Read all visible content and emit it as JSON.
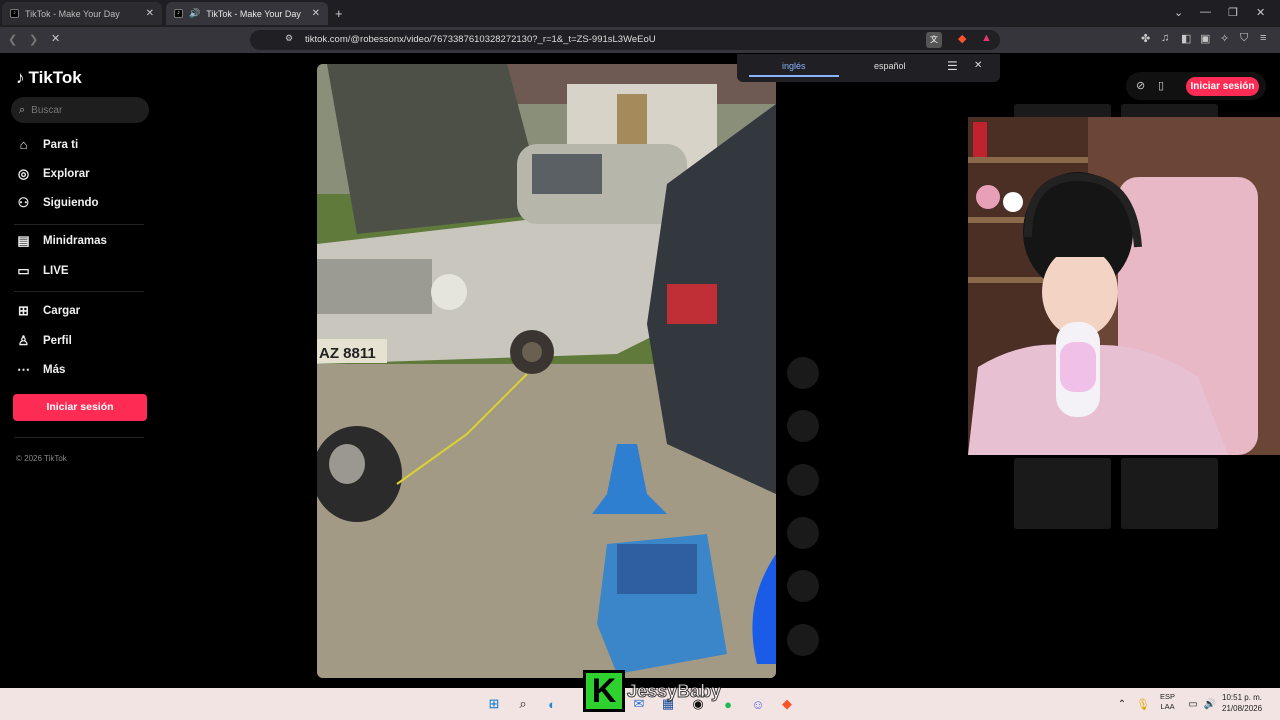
{
  "browser": {
    "tabs": [
      {
        "title": "TikTok - Make Your Day",
        "active": false
      },
      {
        "title": "TikTok - Make Your Day",
        "active": true
      }
    ],
    "url": "tiktok.com/@robessonx/video/7673387610328272130?_r=1&_t=ZS-991sL3WeEoU"
  },
  "translate_popup": {
    "lang_from": "inglés",
    "lang_to": "español"
  },
  "tiktok": {
    "logo": "TikTok",
    "search_placeholder": "Buscar",
    "nav": [
      {
        "label": "Para ti",
        "icon": "home-icon"
      },
      {
        "label": "Explorar",
        "icon": "compass-icon"
      },
      {
        "label": "Siguiendo",
        "icon": "following-icon"
      },
      {
        "label": "Minidramas",
        "icon": "minidramas-icon"
      },
      {
        "label": "LIVE",
        "icon": "live-icon"
      },
      {
        "label": "Cargar",
        "icon": "upload-icon"
      },
      {
        "label": "Perfil",
        "icon": "profile-icon"
      },
      {
        "label": "Más",
        "icon": "more-icon"
      }
    ],
    "login_label": "Iniciar sesión",
    "copyright": "© 2026 TikTok",
    "top_login_label": "Iniciar sesión"
  },
  "video": {
    "plate": "AZ 8811"
  },
  "stream_overlay": {
    "name": "JessyBaby"
  },
  "taskbar": {
    "lang_top": "ESP",
    "lang_bottom": "LAA",
    "time": "10:51 p. m.",
    "date": "21/08/2026"
  },
  "colors": {
    "accent": "#fe2c55",
    "taskbar": "#f3e4e4"
  }
}
